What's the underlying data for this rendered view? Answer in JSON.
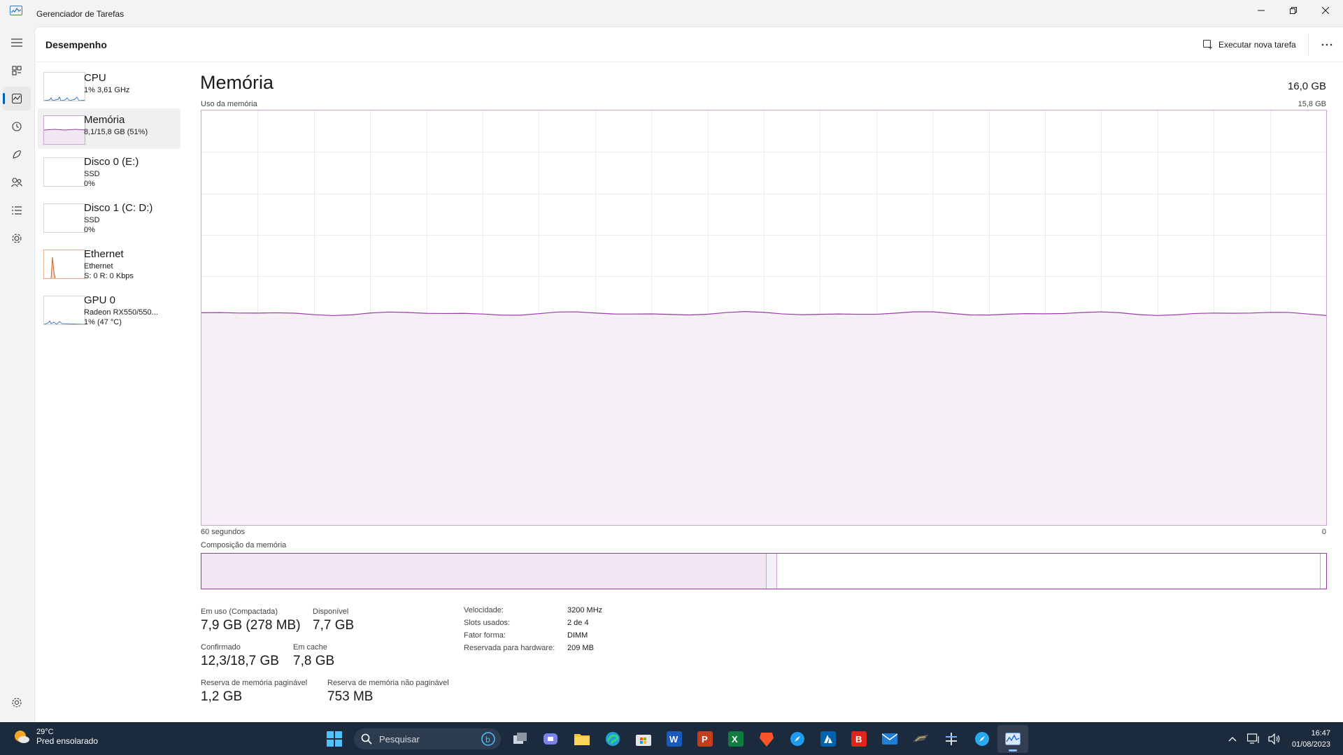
{
  "window": {
    "title": "Gerenciador de Tarefas"
  },
  "header": {
    "title": "Desempenho",
    "run_task_label": "Executar nova tarefa"
  },
  "devices": [
    {
      "name": "CPU",
      "line1": "1% 3,61 GHz",
      "line2": ""
    },
    {
      "name": "Memória",
      "line1": "8,1/15,8 GB (51%)",
      "line2": ""
    },
    {
      "name": "Disco 0 (E:)",
      "line1": "SSD",
      "line2": "0%"
    },
    {
      "name": "Disco 1 (C: D:)",
      "line1": "SSD",
      "line2": "0%"
    },
    {
      "name": "Ethernet",
      "line1": "Ethernet",
      "line2": "S: 0 R: 0 Kbps"
    },
    {
      "name": "GPU 0",
      "line1": "Radeon RX550/550...",
      "line2": "1% (47 °C)"
    }
  ],
  "main": {
    "title": "Memória",
    "capacity": "16,0 GB",
    "graph_label": "Uso da memória",
    "graph_max": "15,8 GB",
    "time_left": "60 segundos",
    "time_right": "0",
    "composition_label": "Composição da memória",
    "usage_fraction": 0.51,
    "line_color": "#9b3aa8"
  },
  "stats": {
    "in_use_label": "Em uso (Compactada)",
    "in_use_value": "7,9 GB (278 MB)",
    "available_label": "Disponível",
    "available_value": "7,7 GB",
    "committed_label": "Confirmado",
    "committed_value": "12,3/18,7 GB",
    "cached_label": "Em cache",
    "cached_value": "7,8 GB",
    "paged_label": "Reserva de memória paginável",
    "paged_value": "1,2 GB",
    "nonpaged_label": "Reserva de memória não paginável",
    "nonpaged_value": "753 MB"
  },
  "specs": [
    {
      "key": "Velocidade:",
      "value": "3200 MHz"
    },
    {
      "key": "Slots usados:",
      "value": "2 de 4"
    },
    {
      "key": "Fator forma:",
      "value": "DIMM"
    },
    {
      "key": "Reservada para hardware:",
      "value": "209 MB"
    }
  ],
  "taskbar": {
    "temperature": "29°C",
    "weather": "Pred ensolarado",
    "search_placeholder": "Pesquisar",
    "time": "16:47",
    "date": "01/08/2023"
  }
}
